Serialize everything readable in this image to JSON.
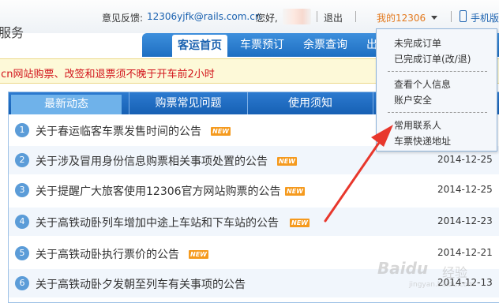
{
  "header": {
    "brand": "服务",
    "feedback_label": "意见反馈:",
    "feedback_email": "12306yjfk@rails.com.cn",
    "greeting": "您好,",
    "logout": "退出",
    "my12306": "我的12306",
    "mobile": "手机版"
  },
  "nav": {
    "items": [
      "客运首页",
      "车票预订",
      "余票查询",
      "出"
    ]
  },
  "notice": {
    "text": ".cn网站购票、改签和退票须不晚于开车前2小时"
  },
  "tabs": [
    "最新动态",
    "购票常见问题",
    "使用须知"
  ],
  "news": [
    {
      "num": "1",
      "title": "关于春运临客车票发售时间的公告",
      "badge": "NEW",
      "date": ""
    },
    {
      "num": "2",
      "title": "关于涉及冒用身份信息购票相关事项处置的公告",
      "badge": "NEW",
      "date": "2014-12-25"
    },
    {
      "num": "3",
      "title": "关于提醒广大旅客使用12306官方网站购票的公告",
      "badge": "NEW",
      "date": "2014-12-25"
    },
    {
      "num": "4",
      "title": "关于高铁动卧列车增加中途上车站和下车站的公告",
      "badge": "NEW",
      "date": "2014-12-23"
    },
    {
      "num": "5",
      "title": "关于高铁动卧执行票价的公告",
      "badge": "NEW",
      "date": "2014-12-21"
    },
    {
      "num": "6",
      "title": "关于高铁动卧夕发朝至列车有关事项的公告",
      "badge": "",
      "date": "2014-12-13"
    }
  ],
  "dropdown": {
    "items": [
      "未完成订单",
      "已完成订单(改/退)",
      "查看个人信息",
      "账户安全",
      "常用联系人",
      "车票快递地址"
    ]
  },
  "watermark": {
    "brand": "Baidu",
    "sub": "经验",
    "url": "jingyan.baidu.com"
  },
  "colors": {
    "nav_blue": "#1e6fc2",
    "accent_orange": "#e3791d",
    "notice_red": "#d2141b",
    "arrow_red": "#e8372c"
  },
  "icons": [
    "user-avatar",
    "dropdown-caret-icon",
    "mobile-phone-icon",
    "new-badge",
    "red-arrow-annotation"
  ]
}
